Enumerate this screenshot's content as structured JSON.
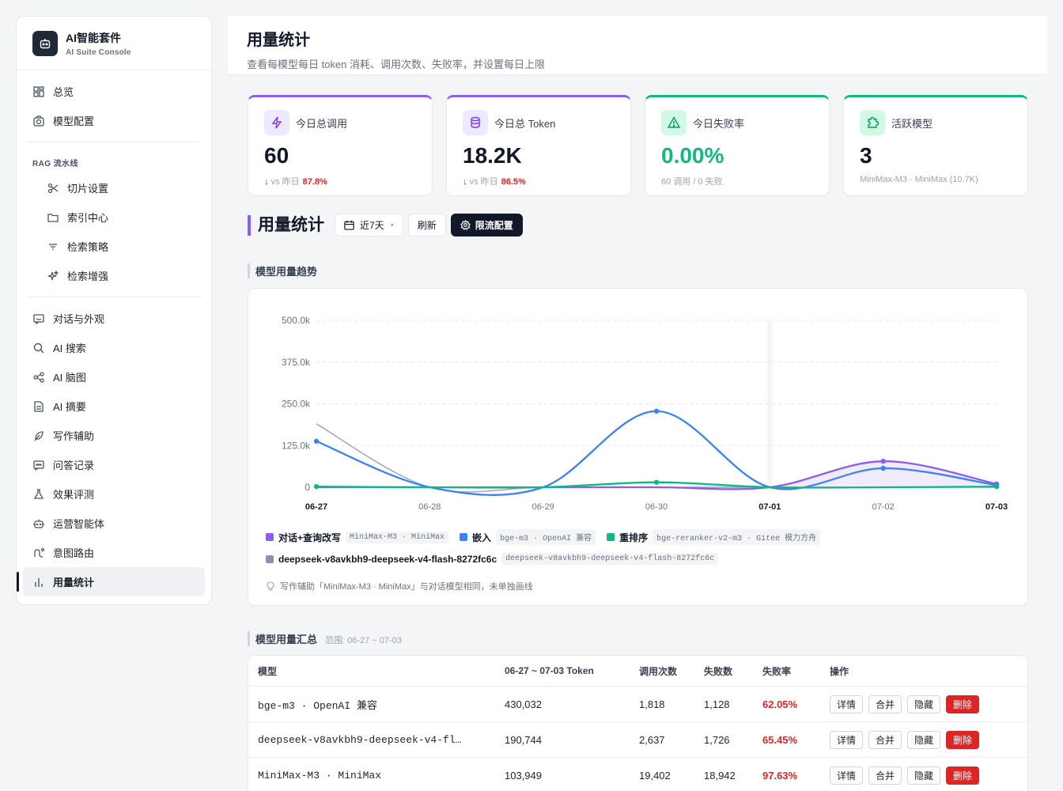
{
  "brand": {
    "title": "AI智能套件",
    "subtitle": "AI Suite Console"
  },
  "sidebar": {
    "top_items": [
      {
        "label": "总览",
        "icon": "grid-icon"
      },
      {
        "label": "模型配置",
        "icon": "camera-icon"
      }
    ],
    "rag_group": "RAG 流水线",
    "rag_items": [
      {
        "label": "切片设置",
        "icon": "scissors-icon"
      },
      {
        "label": "索引中心",
        "icon": "folder-icon"
      },
      {
        "label": "检索策略",
        "icon": "filter-icon"
      },
      {
        "label": "检索增强",
        "icon": "sparkle-icon"
      }
    ],
    "items": [
      {
        "label": "对话与外观",
        "icon": "chat-icon"
      },
      {
        "label": "AI 搜索",
        "icon": "search-icon"
      },
      {
        "label": "AI 脑图",
        "icon": "mindmap-icon"
      },
      {
        "label": "AI 摘要",
        "icon": "document-icon"
      },
      {
        "label": "写作辅助",
        "icon": "feather-icon"
      },
      {
        "label": "问答记录",
        "icon": "message-icon"
      },
      {
        "label": "效果评测",
        "icon": "flask-icon"
      },
      {
        "label": "运营智能体",
        "icon": "robot-icon"
      },
      {
        "label": "意图路由",
        "icon": "route-icon"
      },
      {
        "label": "用量统计",
        "icon": "bar-chart-icon"
      }
    ]
  },
  "header": {
    "title": "用量统计",
    "subtitle": "查看每模型每日 token 消耗、调用次数、失败率，并设置每日上限"
  },
  "stats": [
    {
      "label": "今日总调用",
      "value": "60",
      "foot_prefix": "vs 昨日",
      "foot_pct": "87.8%",
      "icon": "bolt-icon",
      "accent": "#8b5cf6"
    },
    {
      "label": "今日总 Token",
      "value": "18.2K",
      "foot_prefix": "vs 昨日",
      "foot_pct": "86.5%",
      "icon": "database-icon",
      "accent": "#8b5cf6"
    },
    {
      "label": "今日失败率",
      "value": "0.00%",
      "foot": "60 调用 / 0 失败",
      "icon": "warning-icon",
      "accent": "#10b981"
    },
    {
      "label": "活跃模型",
      "value": "3",
      "foot": "MiniMax-M3 · MiniMax (10.7K)",
      "icon": "puzzle-icon",
      "accent": "#10b981"
    }
  ],
  "toolbar": {
    "title": "用量统计",
    "range": "近7天",
    "refresh": "刷新",
    "limit": "限流配置"
  },
  "trend": {
    "title": "模型用量趋势"
  },
  "chart_data": {
    "type": "line",
    "x": [
      "06-27",
      "06-28",
      "06-29",
      "06-30",
      "07-01",
      "07-02",
      "07-03"
    ],
    "ylim": [
      0,
      500000
    ],
    "yticks": [
      "0",
      "125.0k",
      "250.0k",
      "375.0k",
      "500.0k"
    ],
    "ytick_values": [
      0,
      125000,
      250000,
      375000,
      500000
    ],
    "grid": true,
    "series": [
      {
        "name": "对话+查询改写",
        "tag": "MiniMax-M3 · MiniMax",
        "color": "#8b5cf6",
        "values": [
          0,
          0,
          0,
          0,
          0,
          78000,
          10000
        ],
        "fill": true
      },
      {
        "name": "嵌入",
        "tag": "bge-m3 · OpenAI 兼容",
        "color": "#3b82f6",
        "values": [
          138000,
          0,
          0,
          228000,
          0,
          57000,
          6000
        ]
      },
      {
        "name": "重排序",
        "tag": "bge-reranker-v2-m3 · Gitee 模力方舟",
        "color": "#10b981",
        "values": [
          2000,
          0,
          0,
          15000,
          0,
          0,
          2000
        ]
      },
      {
        "name": "deepseek-v8avkbh9-deepseek-v4-flash-8272fc6c",
        "tag": "deepseek-v8avkbh9-deepseek-v4-flash-8272fc6c",
        "color": "#8a90ad",
        "values": [
          190000,
          0,
          0,
          0,
          0,
          0,
          0
        ]
      }
    ],
    "note": "写作辅助「MiniMax-M3 · MiniMax」与对话模型相同，未单独画线"
  },
  "summary": {
    "title": "模型用量汇总",
    "range": "范围: 06-27 ~ 07-03",
    "columns": [
      "模型",
      "06-27 ~ 07-03 Token",
      "调用次数",
      "失败数",
      "失败率",
      "操作"
    ],
    "rows": [
      {
        "model": "bge-m3 · OpenAI 兼容",
        "tokens": "430,032",
        "calls": "1,818",
        "fails": "1,128",
        "rate": "62.05%"
      },
      {
        "model": "deepseek-v8avkbh9-deepseek-v4-fl…",
        "tokens": "190,744",
        "calls": "2,637",
        "fails": "1,726",
        "rate": "65.45%"
      },
      {
        "model": "MiniMax-M3 · MiniMax",
        "tokens": "103,949",
        "calls": "19,402",
        "fails": "18,942",
        "rate": "97.63%"
      }
    ],
    "actions": {
      "detail": "详情",
      "merge": "合并",
      "hide": "隐藏",
      "delete": "删除"
    }
  }
}
